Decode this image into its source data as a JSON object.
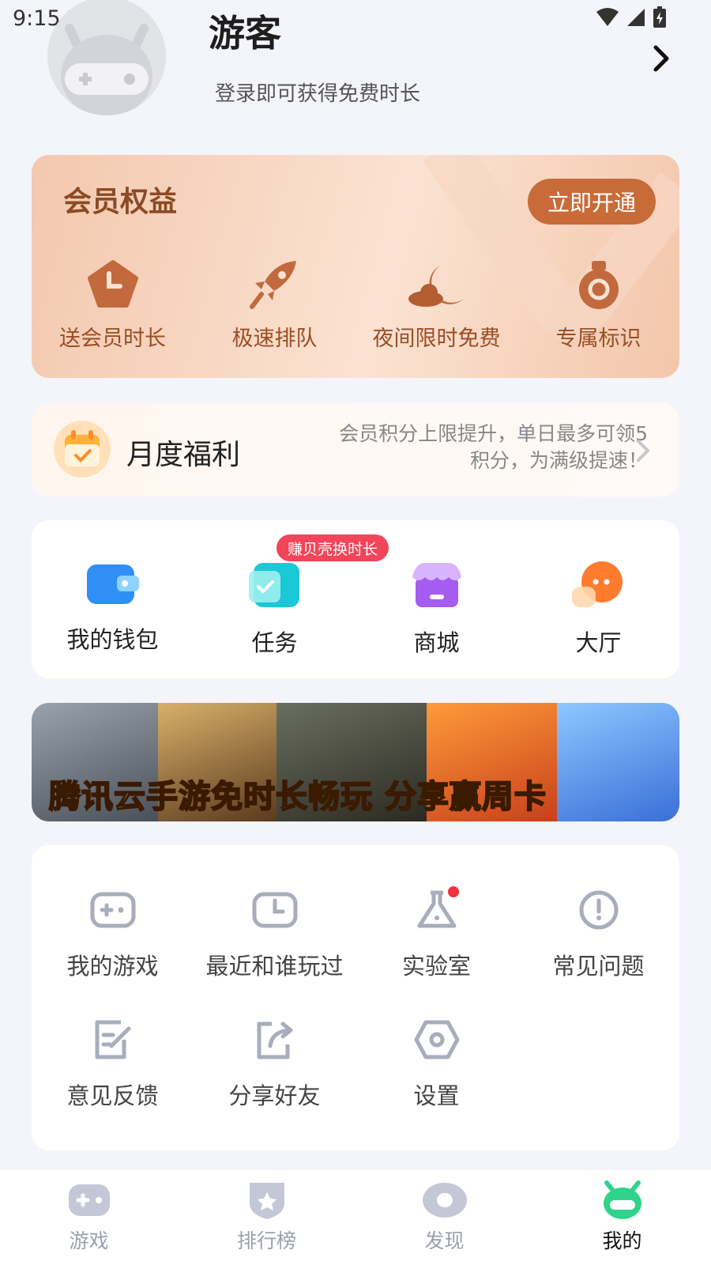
{
  "status_bar": {
    "time": "9:15"
  },
  "profile": {
    "name": "游客",
    "hint": "登录即可获得免费时长"
  },
  "member": {
    "title": "会员权益",
    "button": "立即开通",
    "perks": [
      {
        "label": "送会员时长",
        "icon": "clock-tag-icon"
      },
      {
        "label": "极速排队",
        "icon": "rocket-icon"
      },
      {
        "label": "夜间限时免费",
        "icon": "moon-cloud-icon"
      },
      {
        "label": "专属标识",
        "icon": "medal-icon"
      }
    ]
  },
  "monthly": {
    "title": "月度福利",
    "desc_line1": "会员积分上限提升，单日最多可领5",
    "desc_line2": "积分，为满级提速！"
  },
  "quick_actions": {
    "badge": "赚贝壳换时长",
    "items": [
      {
        "label": "我的钱包",
        "icon": "wallet-icon"
      },
      {
        "label": "任务",
        "icon": "task-icon"
      },
      {
        "label": "商城",
        "icon": "shop-icon"
      },
      {
        "label": "大厅",
        "icon": "chat-icon"
      }
    ]
  },
  "banner": {
    "text_part1": "腾讯云手游",
    "text_part2": "免时长畅玩",
    "text_part3": "分享赢周卡"
  },
  "tools": [
    {
      "label": "我的游戏",
      "icon": "gamepad-icon"
    },
    {
      "label": "最近和谁玩过",
      "icon": "recent-clock-icon"
    },
    {
      "label": "实验室",
      "icon": "flask-icon"
    },
    {
      "label": "常见问题",
      "icon": "exclamation-icon"
    },
    {
      "label": "意见反馈",
      "icon": "feedback-icon"
    },
    {
      "label": "分享好友",
      "icon": "share-icon"
    },
    {
      "label": "设置",
      "icon": "settings-icon"
    }
  ],
  "bottom_nav": [
    {
      "label": "游戏",
      "active": false
    },
    {
      "label": "排行榜",
      "active": false
    },
    {
      "label": "发现",
      "active": false
    },
    {
      "label": "我的",
      "active": true
    }
  ],
  "colors": {
    "accent": "#c96b39",
    "badge": "#f3455a",
    "active_nav": "#2fd38a"
  }
}
